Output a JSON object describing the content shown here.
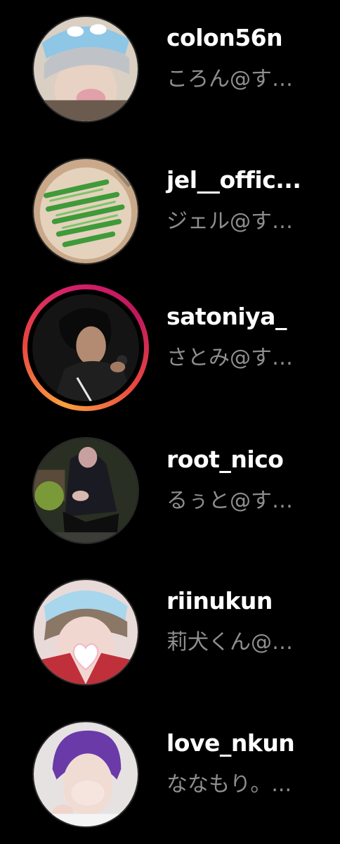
{
  "colors": {
    "background": "#000000",
    "username": "#ffffff",
    "subtitle": "#8e8e8e",
    "story_ring_start": "#f9a03f",
    "story_ring_end": "#d4206a"
  },
  "accounts": [
    {
      "username": "colon56n",
      "subtitle": "ころん@す…",
      "avatar": "avatar-photo",
      "has_story": false
    },
    {
      "username": "jel__offic...",
      "subtitle": "ジェル@す…",
      "avatar": "avatar-photo",
      "has_story": false
    },
    {
      "username": "satoniya_",
      "subtitle": "さとみ@す…",
      "avatar": "avatar-photo",
      "has_story": true
    },
    {
      "username": "root_nico",
      "subtitle": "るぅと@す…",
      "avatar": "avatar-photo",
      "has_story": false
    },
    {
      "username": "riinukun",
      "subtitle": "莉犬くん@…",
      "avatar": "avatar-photo",
      "has_story": false
    },
    {
      "username": "love_nkun",
      "subtitle": "ななもり。...",
      "avatar": "avatar-photo",
      "has_story": false
    }
  ]
}
